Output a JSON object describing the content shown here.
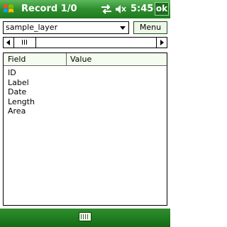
{
  "titlebar": {
    "title": "Record 1/0",
    "time": "5:45",
    "ok_label": "ok",
    "start_icon": "windows-start-icon",
    "connectivity_icon": "sync-arrows-icon",
    "volume_icon": "speaker-muted-icon"
  },
  "toolbar": {
    "layer_selected": "sample_layer",
    "menu_label": "Menu"
  },
  "table": {
    "headers": [
      "Field",
      "Value"
    ],
    "fields": [
      "ID",
      "Label",
      "Date",
      "Length",
      "Area"
    ]
  },
  "bottombar": {
    "keyboard_icon": "keyboard-icon"
  },
  "colors": {
    "bar_green": "#2f8d2f",
    "menu_bg": "#eef7e8"
  }
}
